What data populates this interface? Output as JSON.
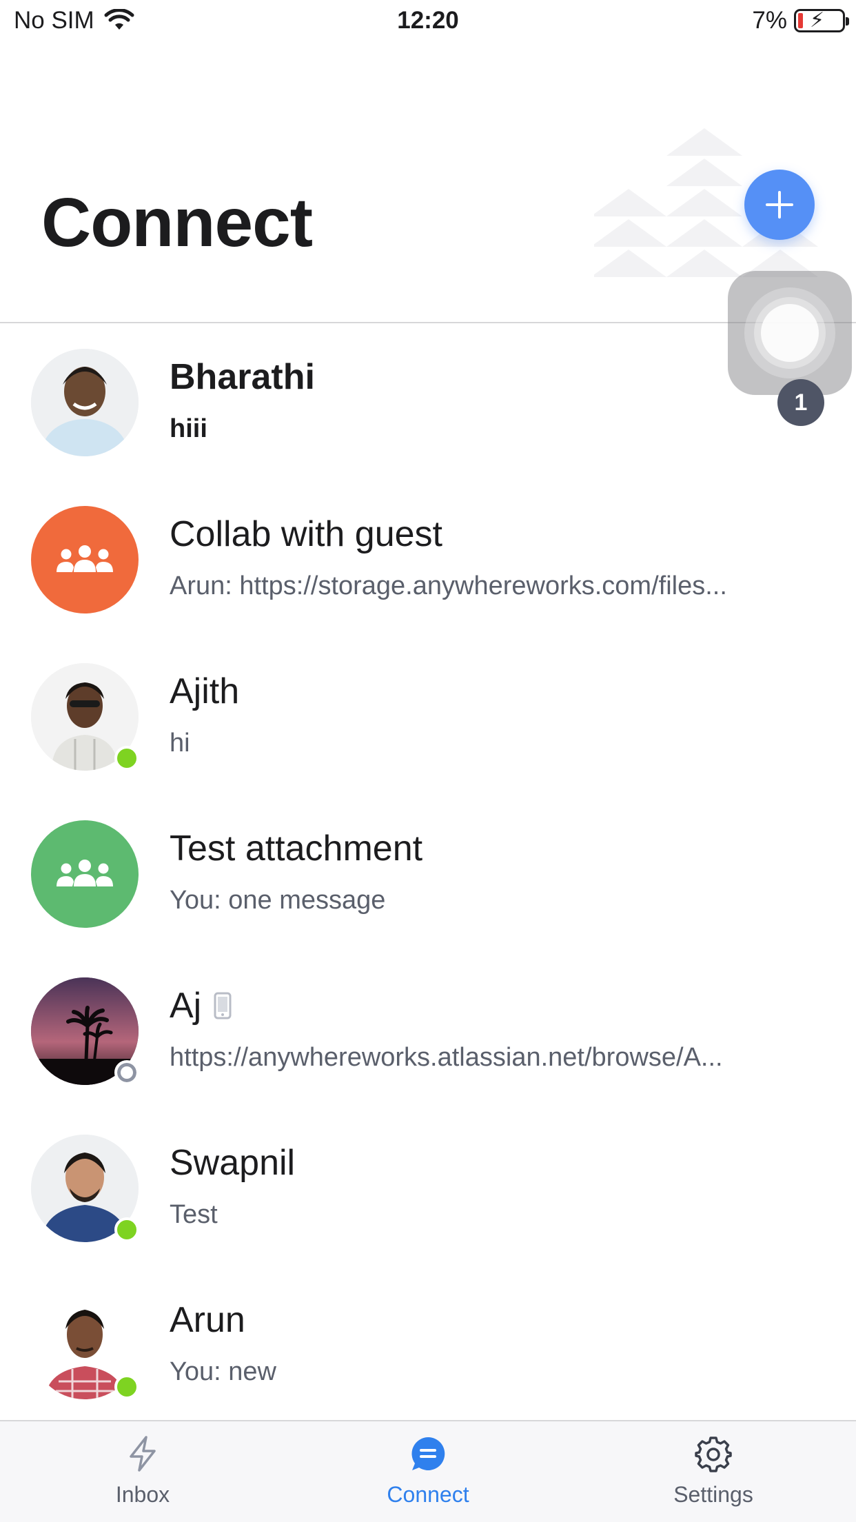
{
  "status_bar": {
    "carrier": "No SIM",
    "time": "12:20",
    "battery": "7%"
  },
  "header": {
    "title": "Connect"
  },
  "assistive_badge": "1",
  "colors": {
    "fab": "#5590f6",
    "accent": "#2f80ed",
    "online": "#7ed321",
    "group_collab": "#f06a3c",
    "group_test": "#5dba70"
  },
  "conversations": [
    {
      "name": "Bharathi",
      "preview": "hiii",
      "unread": true,
      "avatar": "photo",
      "presence": "none"
    },
    {
      "name": "Collab with guest",
      "preview": "Arun: https://storage.anywhereworks.com/files...",
      "unread": false,
      "avatar": "group-icon",
      "presence": "none"
    },
    {
      "name": "Ajith",
      "preview": "hi",
      "unread": false,
      "avatar": "photo",
      "presence": "online"
    },
    {
      "name": "Test attachment",
      "preview": "You: one message",
      "unread": false,
      "avatar": "group-icon",
      "presence": "none"
    },
    {
      "name": "Aj",
      "preview": "https://anywhereworks.atlassian.net/browse/A...",
      "unread": false,
      "avatar": "photo",
      "presence": "offline",
      "device_icon": "mobile-icon"
    },
    {
      "name": "Swapnil",
      "preview": "Test",
      "unread": false,
      "avatar": "photo",
      "presence": "online"
    },
    {
      "name": "Arun",
      "preview": "You: new",
      "unread": false,
      "avatar": "photo",
      "presence": "online"
    }
  ],
  "tabs": [
    {
      "label": "Inbox",
      "icon": "bolt-icon",
      "active": false
    },
    {
      "label": "Connect",
      "icon": "chat-icon",
      "active": true
    },
    {
      "label": "Settings",
      "icon": "gear-icon",
      "active": false
    }
  ]
}
